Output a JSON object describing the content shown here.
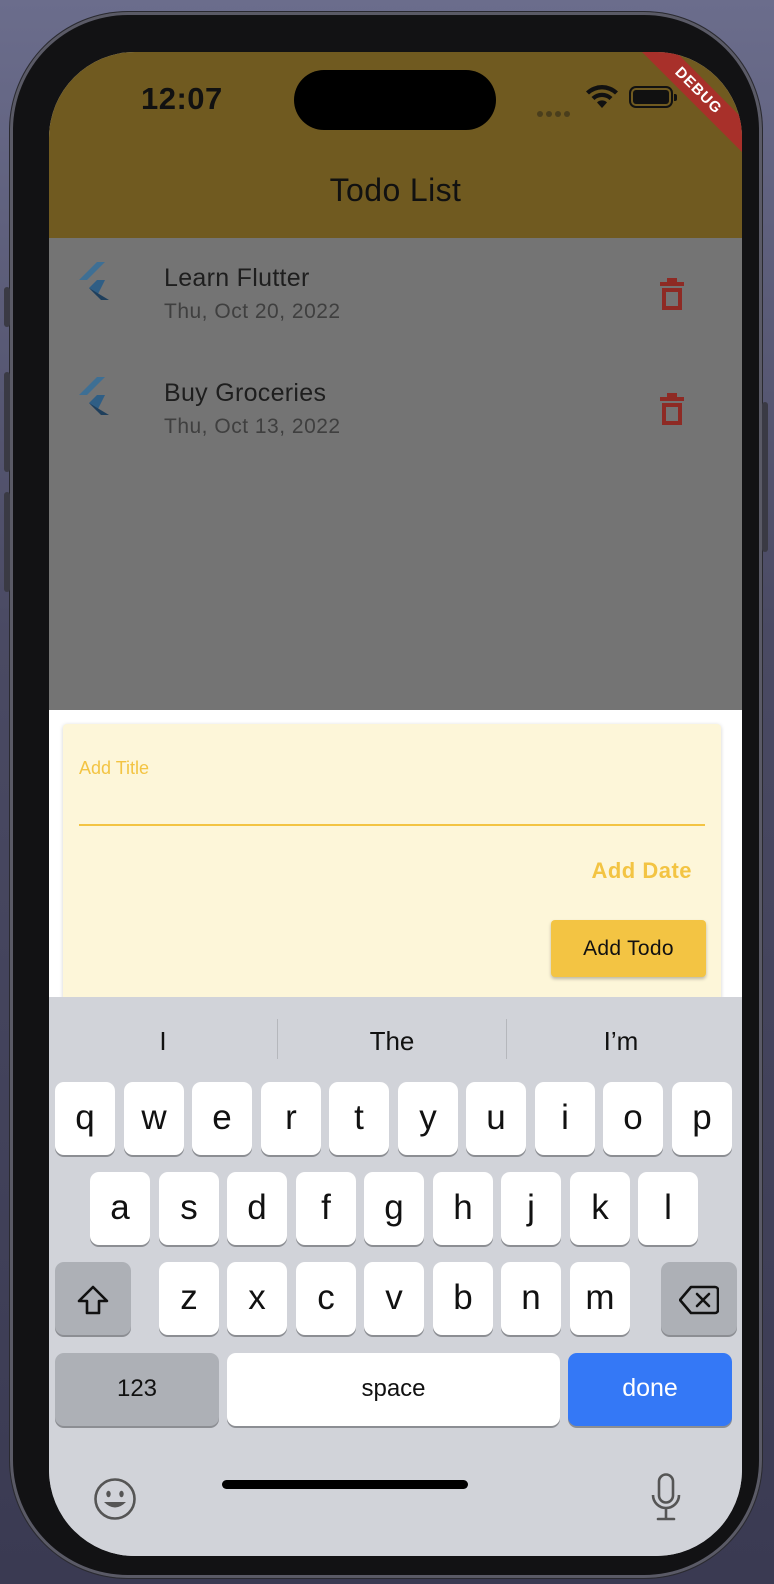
{
  "status_bar": {
    "time": "12:07"
  },
  "debug_banner": "DEBUG",
  "app_bar": {
    "title": "Todo List"
  },
  "todos": [
    {
      "title": "Learn Flutter",
      "date": "Thu, Oct 20, 2022"
    },
    {
      "title": "Buy Groceries",
      "date": "Thu, Oct 13, 2022"
    }
  ],
  "form": {
    "title_label": "Add Title",
    "title_value": "",
    "add_date_label": "Add Date",
    "add_todo_label": "Add Todo"
  },
  "keyboard": {
    "suggestions": [
      "I",
      "The",
      "I’m"
    ],
    "row1": [
      "q",
      "w",
      "e",
      "r",
      "t",
      "y",
      "u",
      "i",
      "o",
      "p"
    ],
    "row2": [
      "a",
      "s",
      "d",
      "f",
      "g",
      "h",
      "j",
      "k",
      "l"
    ],
    "row3": [
      "z",
      "x",
      "c",
      "v",
      "b",
      "n",
      "m"
    ],
    "numbers_label": "123",
    "space_label": "space",
    "done_label": "done"
  },
  "colors": {
    "app_bar": "#705a20",
    "accent": "#f3c443",
    "card": "#fdf6d9",
    "delete": "#a8302a",
    "done_key": "#3478f6"
  },
  "icons": [
    "flutter-logo-icon",
    "trash-icon",
    "shift-icon",
    "backspace-icon",
    "emoji-icon",
    "microphone-icon",
    "wifi-icon",
    "battery-icon"
  ]
}
